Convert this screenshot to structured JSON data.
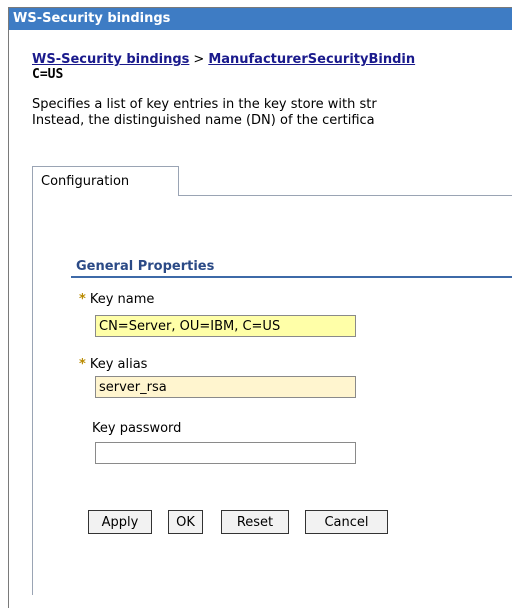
{
  "window": {
    "title": "WS-Security bindings"
  },
  "breadcrumb": {
    "link1": "WS-Security bindings",
    "separator": ">",
    "link2": "ManufacturerSecurityBindin",
    "current": "C=US"
  },
  "description": {
    "line1": "Specifies a list of key entries in the key store with str",
    "line2": "Instead, the distinguished name (DN) of the certifica"
  },
  "tabs": [
    {
      "label": "Configuration"
    }
  ],
  "general_properties": {
    "title": "General Properties",
    "required_marker": "*",
    "key_name": {
      "label": "Key name",
      "value": "CN=Server, OU=IBM, C=US",
      "bg_color": "#ffffa8"
    },
    "key_alias": {
      "label": "Key alias",
      "value": "server_rsa",
      "bg_color": "#fff5cf"
    },
    "key_password": {
      "label": "Key password",
      "value": ""
    }
  },
  "buttons": {
    "apply": "Apply",
    "ok": "OK",
    "reset": "Reset",
    "cancel": "Cancel"
  },
  "colors": {
    "titlebar": "#3e7cc4",
    "link": "#1a1a8c",
    "section_title": "#2b4a86",
    "required_marker": "#b98a00"
  }
}
